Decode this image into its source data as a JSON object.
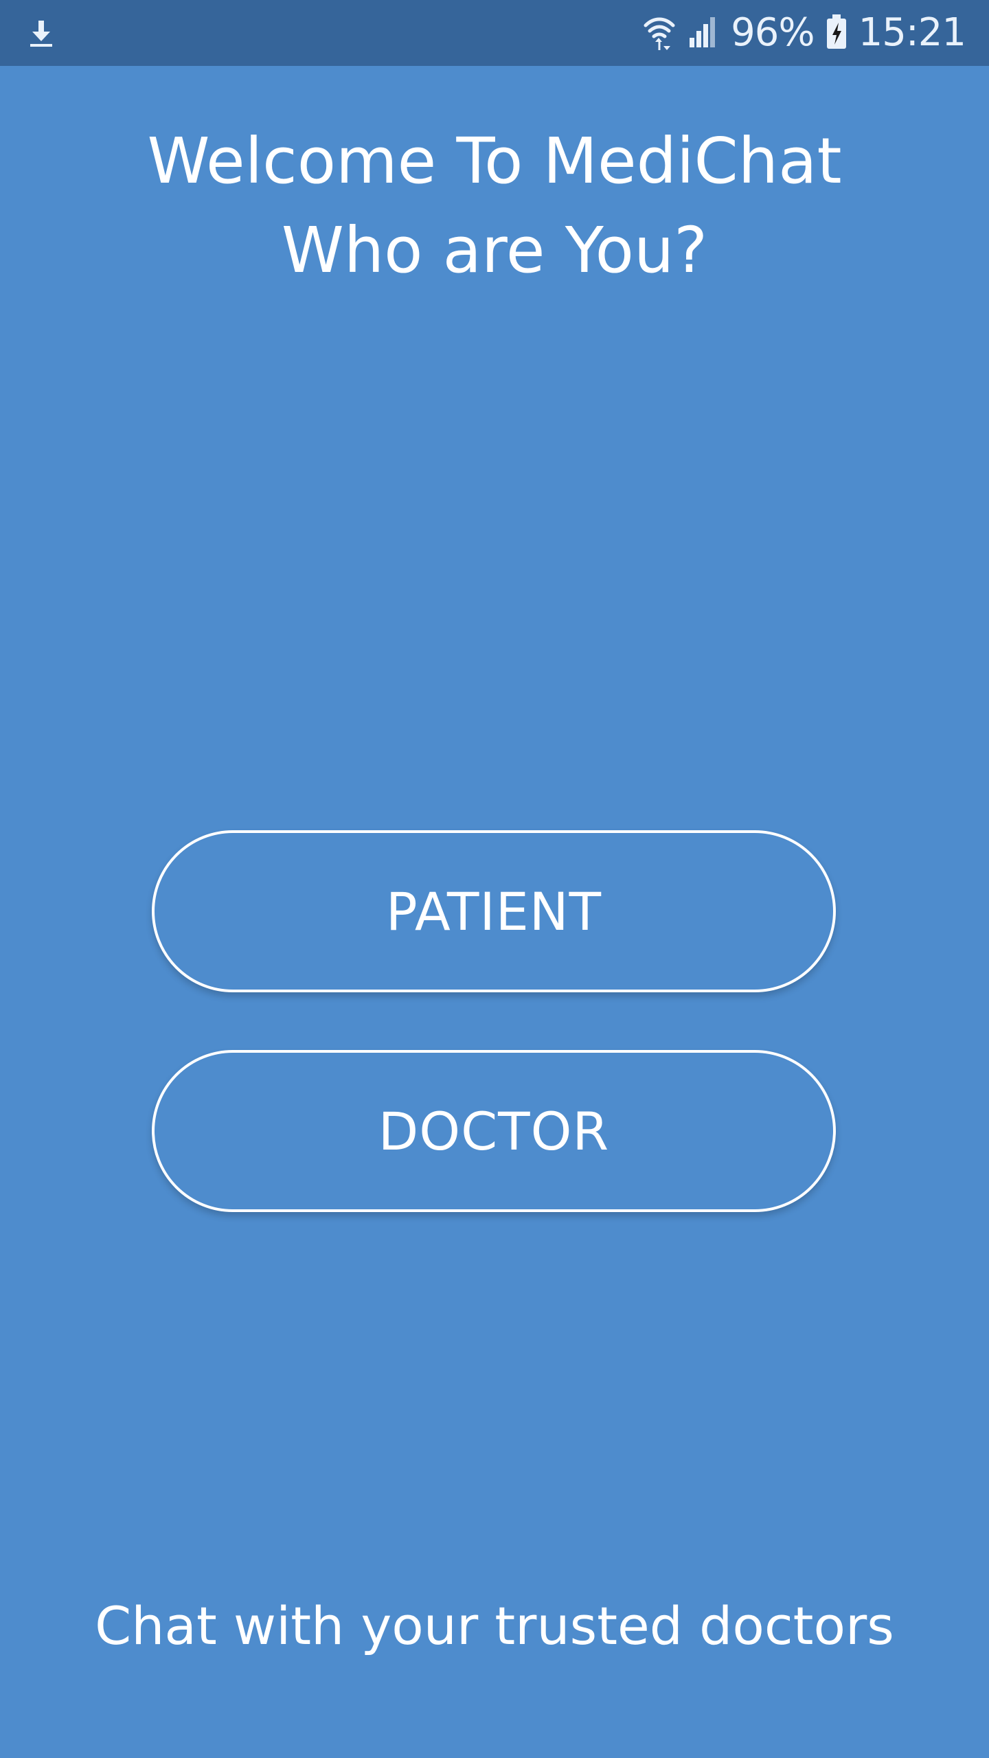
{
  "status_bar": {
    "left_icon": "download-icon",
    "wifi_icon": "wifi-icon",
    "signal_icon": "cell-signal-icon",
    "battery_percent": "96%",
    "battery_icon": "battery-charging-icon",
    "time": "15:21"
  },
  "welcome": {
    "line1": "Welcome To MediChat",
    "line2": "Who are You?"
  },
  "buttons": {
    "patient_label": "PATIENT",
    "doctor_label": "DOCTOR"
  },
  "footer": {
    "tagline": "Chat with your trusted doctors"
  },
  "colors": {
    "background": "#4e8ccd",
    "status_bar": "#36659a",
    "text": "#ffffff"
  }
}
